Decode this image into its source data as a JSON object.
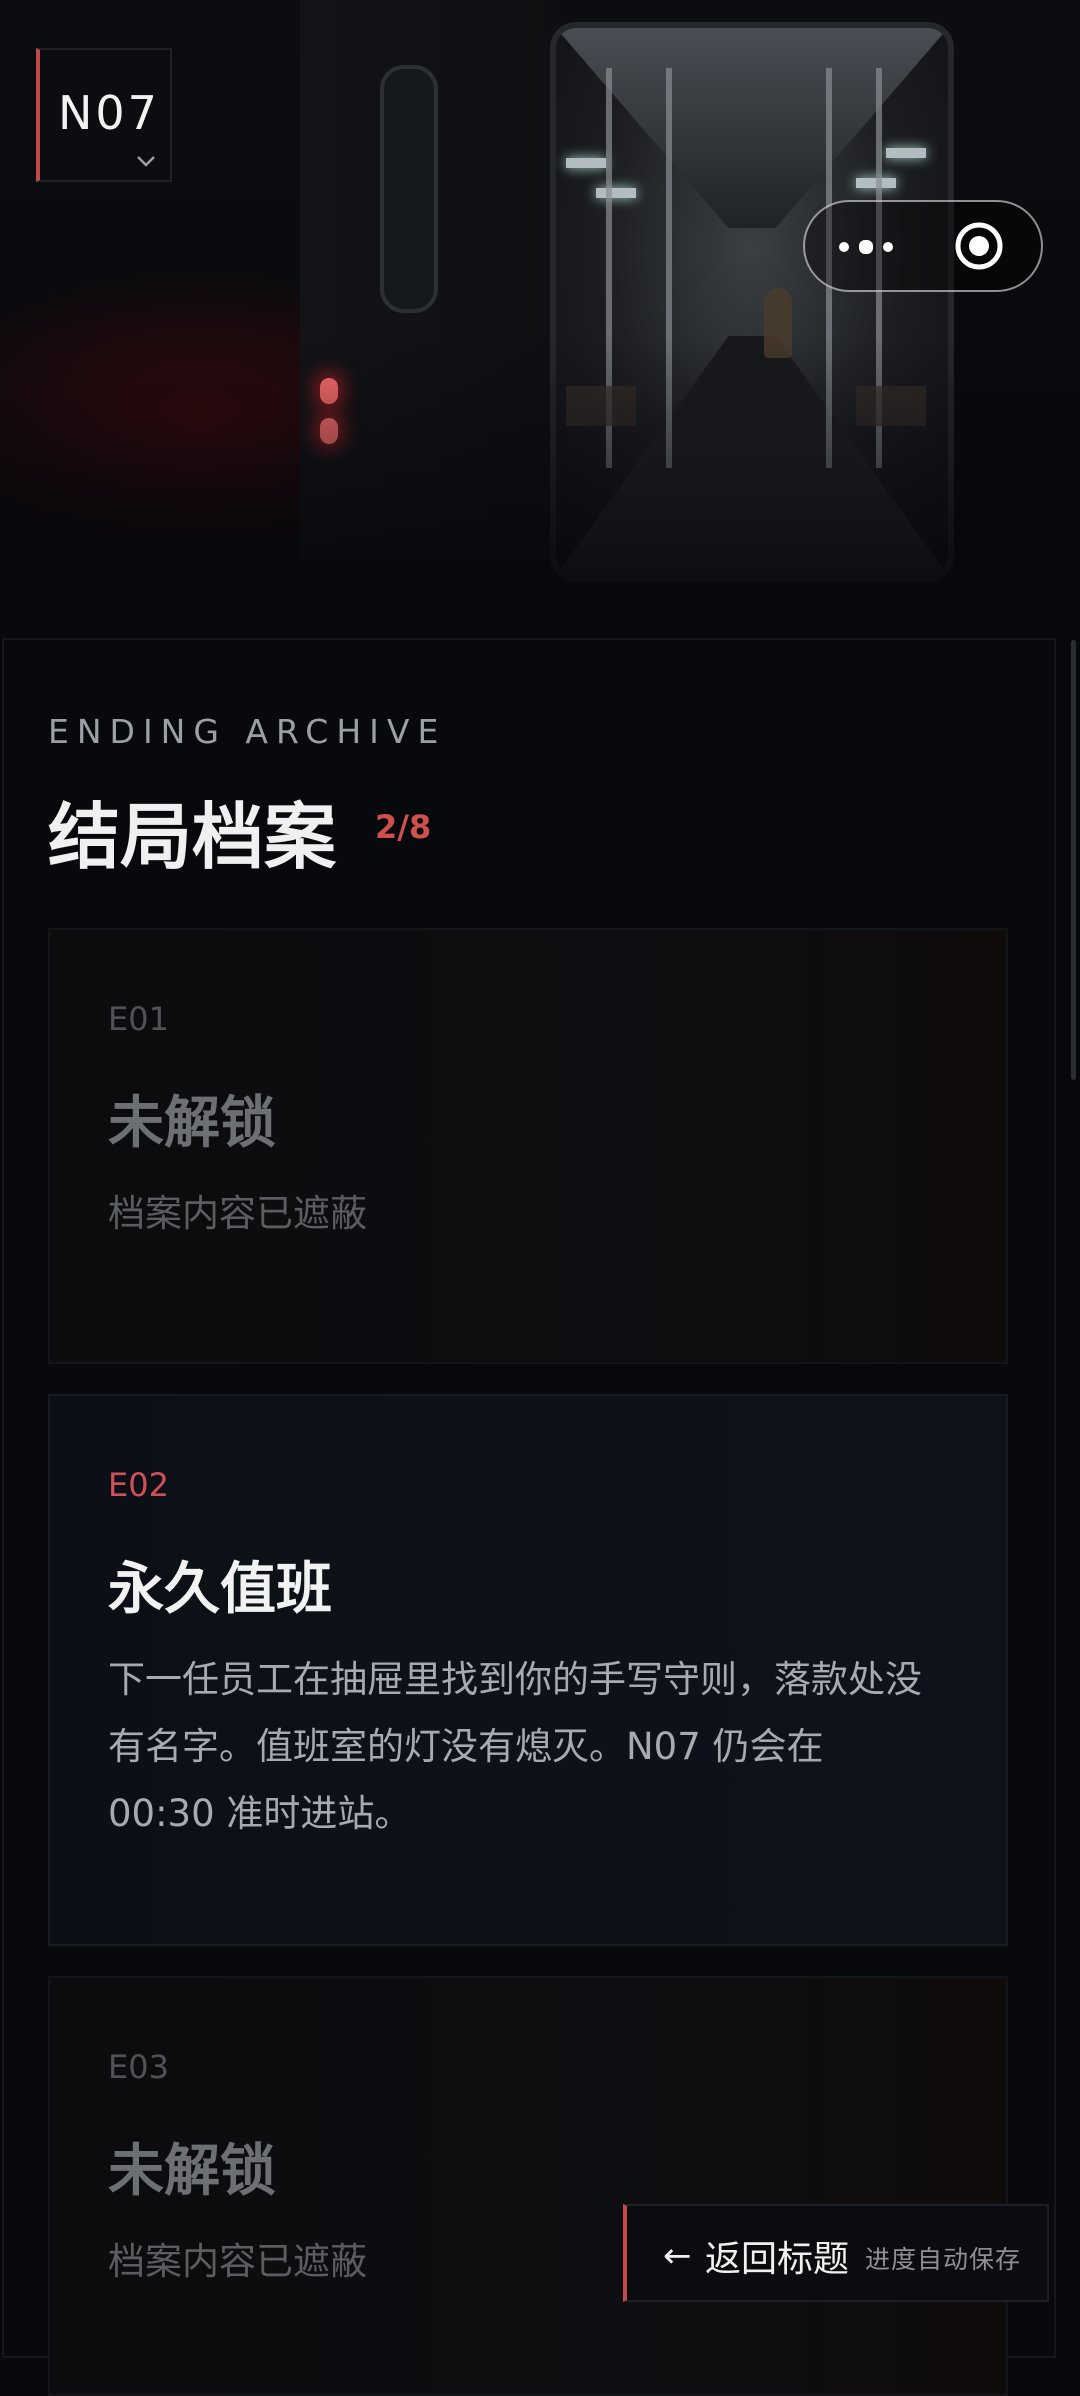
{
  "header": {
    "logo": "N07"
  },
  "archive": {
    "subtitle": "ENDING ARCHIVE",
    "title": "结局档案",
    "progress": "2/8"
  },
  "endings": [
    {
      "code": "E01",
      "name": "未解锁",
      "desc": "档案内容已遮蔽",
      "locked": true
    },
    {
      "code": "E02",
      "name": "永久值班",
      "desc": "下一任员工在抽屉里找到你的手写守则，落款处没有名字。值班室的灯没有熄灭。N07 仍会在 00:30 准时进站。",
      "locked": false
    },
    {
      "code": "E03",
      "name": "未解锁",
      "desc": "档案内容已遮蔽",
      "locked": true
    }
  ],
  "footer": {
    "back_arrow": "←",
    "back_label": "返回标题",
    "save_note": "进度自动保存"
  },
  "colors": {
    "accent": "#c24a4a",
    "code_unlocked": "#d0505a",
    "background": "#06080c"
  },
  "icons": {
    "more": "more-dots-icon",
    "close": "target-circle-icon",
    "logo_dropdown": "chevron-down-icon",
    "back": "arrow-left-icon"
  }
}
